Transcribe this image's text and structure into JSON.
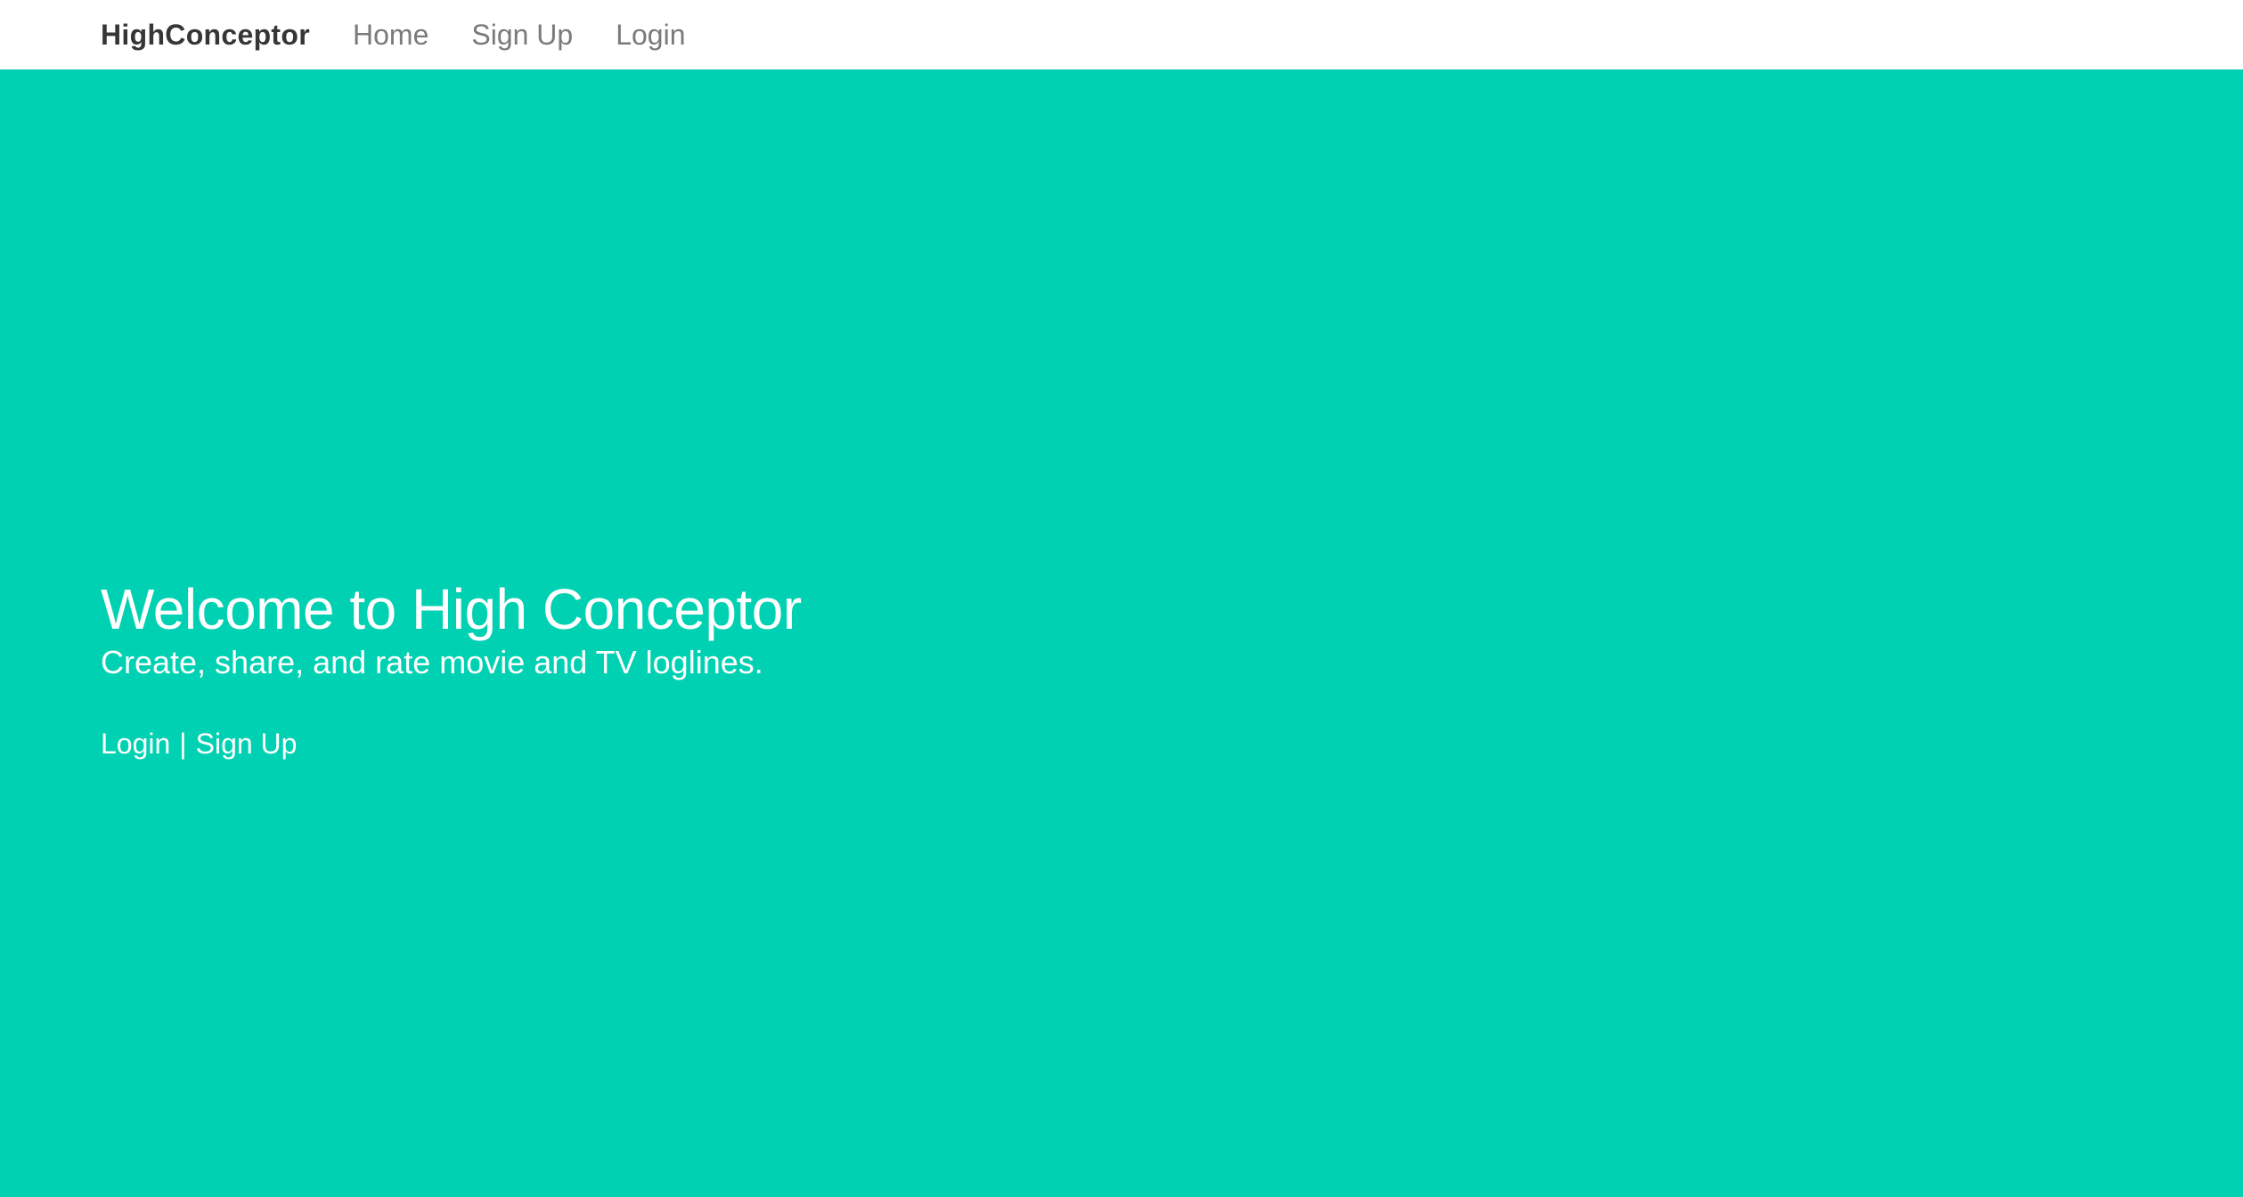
{
  "navbar": {
    "brand": "HighConceptor",
    "links": [
      "Home",
      "Sign Up",
      "Login"
    ]
  },
  "hero": {
    "title": "Welcome to High Conceptor",
    "subtitle": "Create, share, and rate movie and TV loglines.",
    "login_label": "Login",
    "separator": "|",
    "signup_label": "Sign Up"
  },
  "colors": {
    "accent": "#00d1b2",
    "nav_background": "#ffffff",
    "brand_text": "#363636",
    "nav_link_text": "#7a7a7a",
    "hero_text": "#ffffff"
  }
}
